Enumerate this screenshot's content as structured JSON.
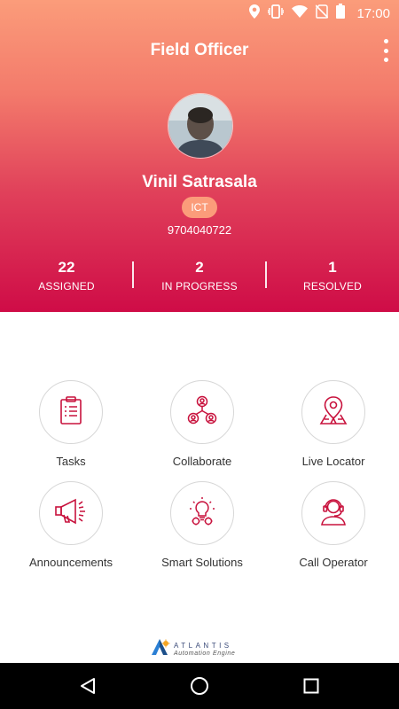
{
  "status_bar": {
    "time": "17:00",
    "icons": [
      "location-icon",
      "vibrate-icon",
      "wifi-icon",
      "no-sim-icon",
      "battery-icon"
    ]
  },
  "app_bar": {
    "title": "Field Officer",
    "menu_icon": "more-vert-icon"
  },
  "profile": {
    "name": "Vinil Satrasala",
    "department": "ICT",
    "phone": "9704040722"
  },
  "stats": [
    {
      "value": "22",
      "label": "ASSIGNED"
    },
    {
      "value": "2",
      "label": "IN PROGRESS"
    },
    {
      "value": "1",
      "label": "RESOLVED"
    }
  ],
  "menu": [
    {
      "label": "Tasks",
      "icon": "clipboard-checklist-icon"
    },
    {
      "label": "Collaborate",
      "icon": "collaborate-people-icon"
    },
    {
      "label": "Live Locator",
      "icon": "map-pin-icon"
    },
    {
      "label": "Announcements",
      "icon": "megaphone-icon"
    },
    {
      "label": "Smart Solutions",
      "icon": "lightbulb-gear-icon"
    },
    {
      "label": "Call Operator",
      "icon": "headset-operator-icon"
    }
  ],
  "brand": {
    "name": "ATLANTIS",
    "tagline": "Automation Engine"
  },
  "nav_bar": {
    "buttons": [
      "back-icon",
      "home-icon",
      "recents-icon"
    ]
  },
  "colors": {
    "accent": "#cf0c47",
    "gradient_top": "#fb9c7a",
    "gradient_bottom": "#cf0c47",
    "icon_red": "#c8123d",
    "badge": "#fb9c7a"
  }
}
